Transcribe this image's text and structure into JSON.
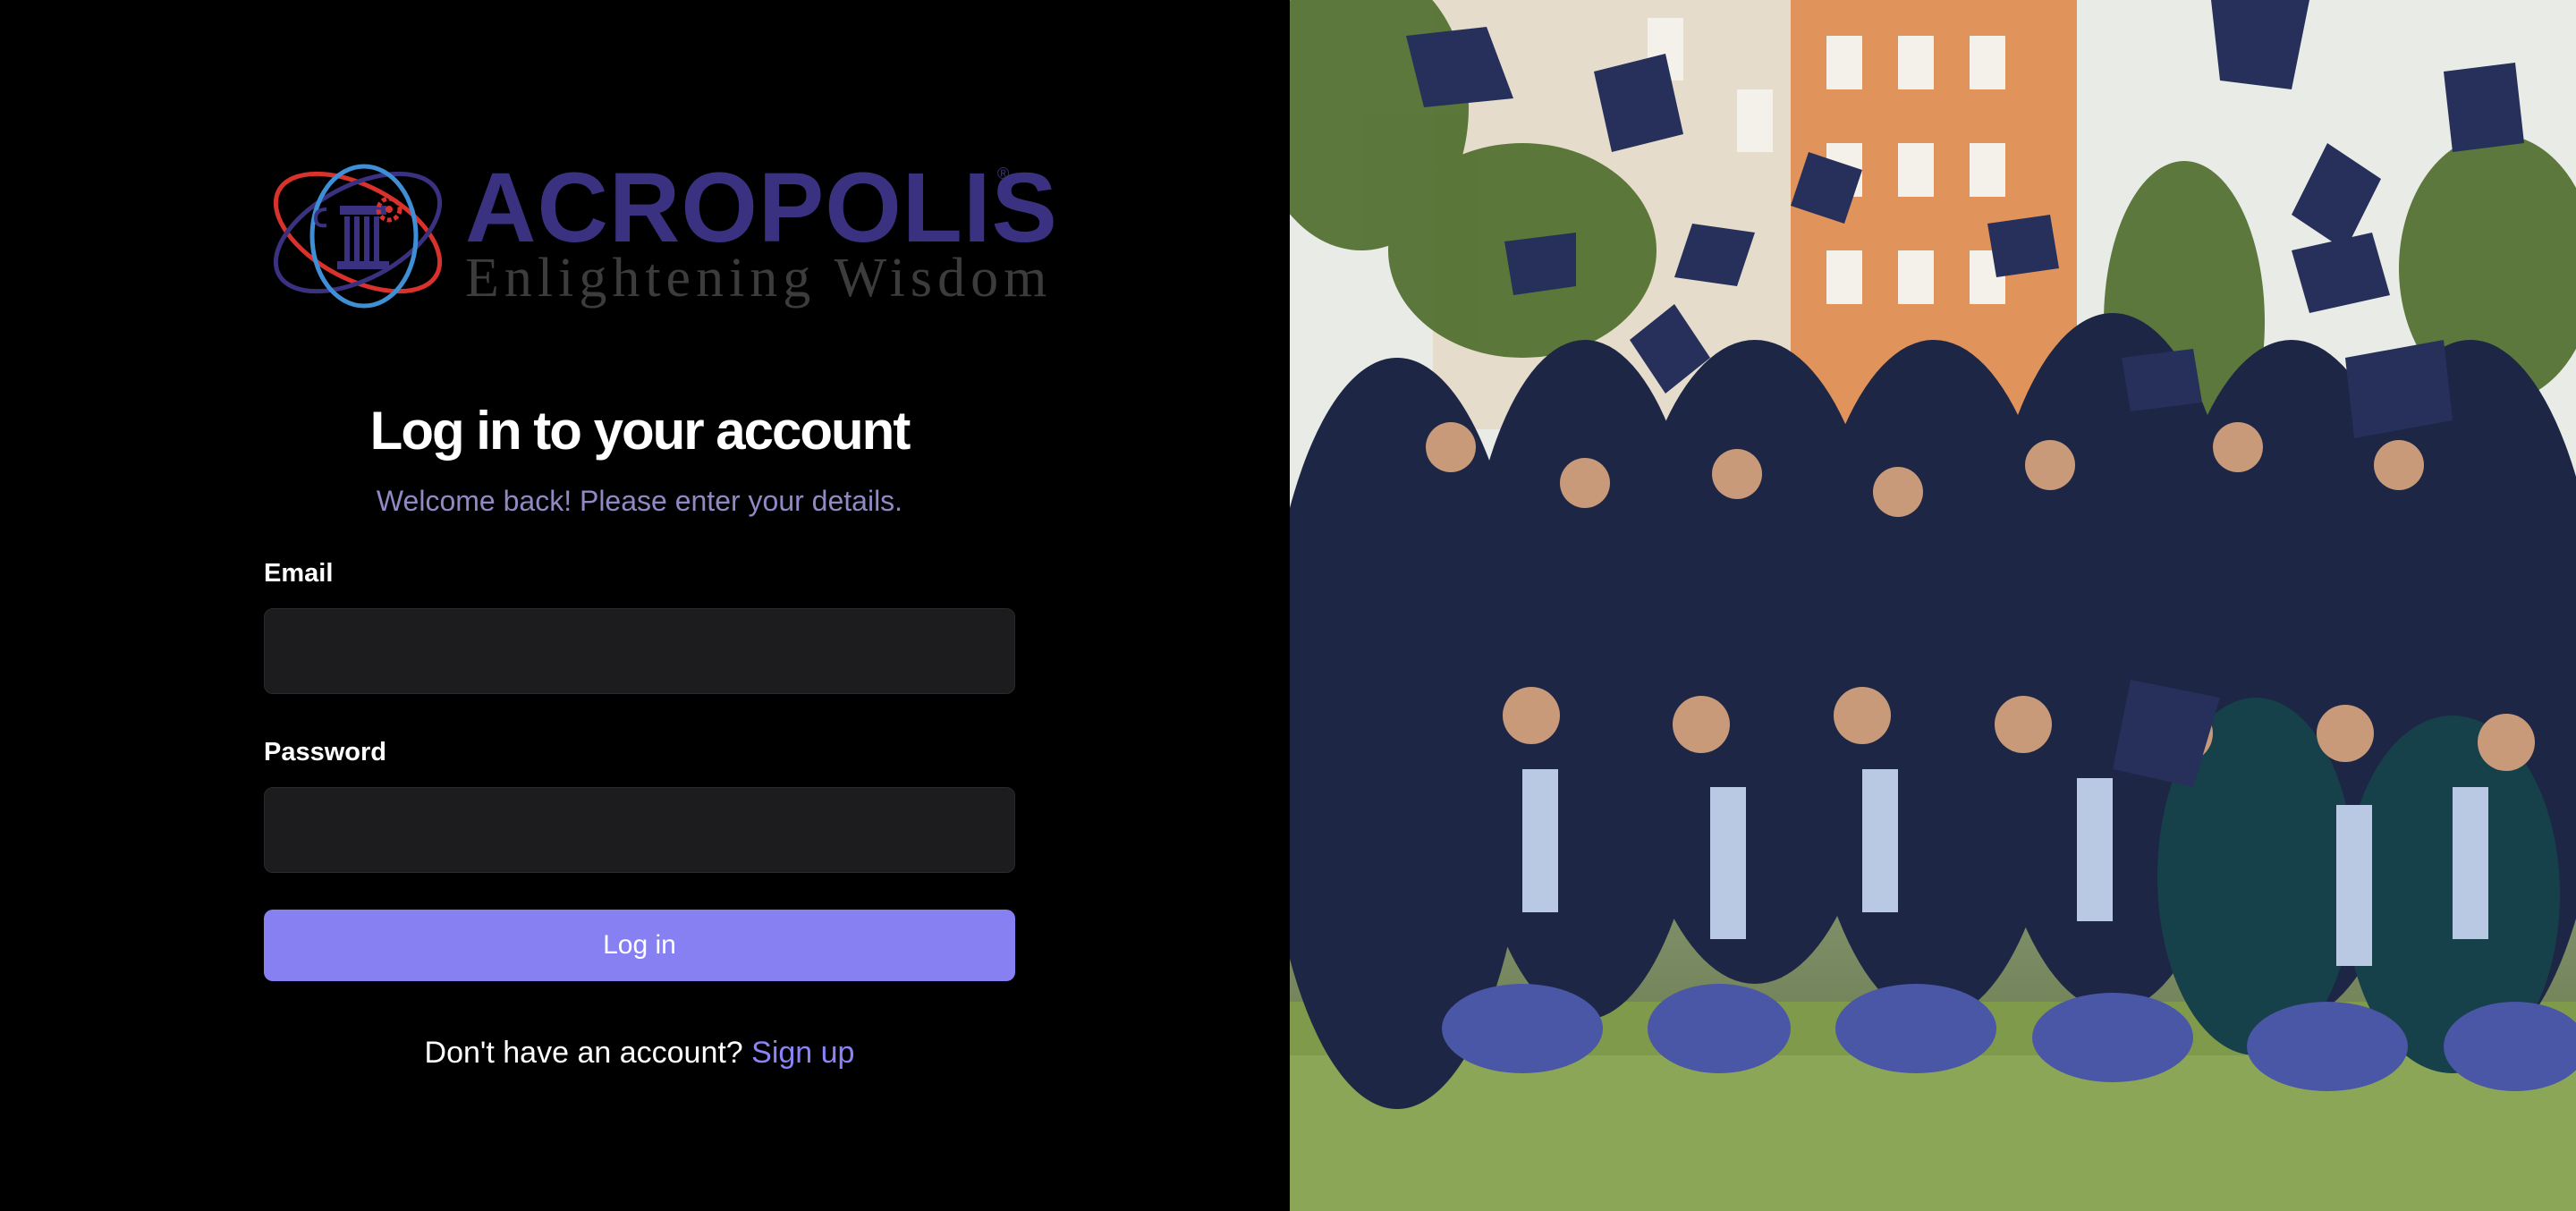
{
  "brand": {
    "name": "ACROPOLIS",
    "registered_mark": "®",
    "tagline": "Enlightening Wisdom",
    "colors": {
      "primary": "#3a3280",
      "accent_red": "#d9312b",
      "accent_blue": "#3f8fd6"
    }
  },
  "login": {
    "title": "Log in to your account",
    "subtitle": "Welcome back! Please enter your details.",
    "email_label": "Email",
    "email_value": "",
    "password_label": "Password",
    "password_value": "",
    "submit_label": "Log in",
    "signup_prompt": "Don't have an account? ",
    "signup_link": "Sign up"
  },
  "colors": {
    "background": "#000000",
    "input_bg": "#1c1c1e",
    "button": "#8780f3",
    "link": "#8b84f5",
    "subtitle": "#8f89c4"
  },
  "hero_image": {
    "subject": "graduates-throwing-caps"
  }
}
